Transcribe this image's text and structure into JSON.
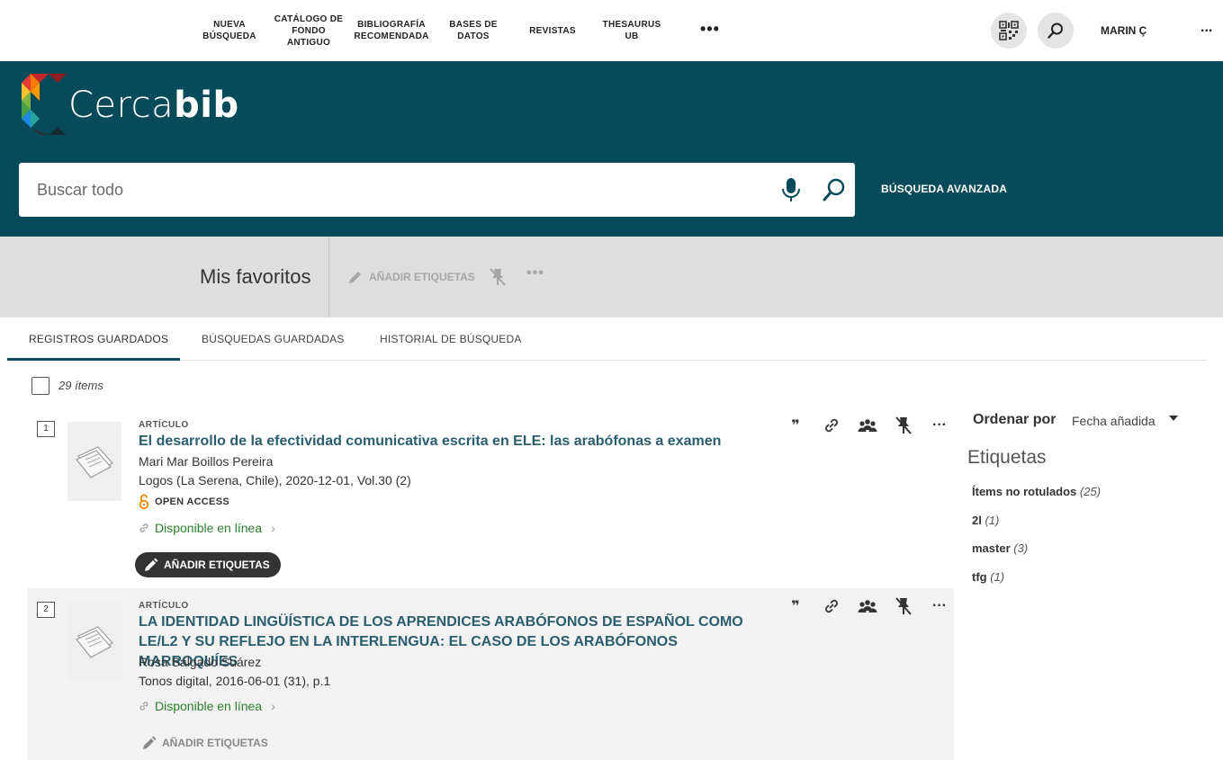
{
  "nav": {
    "items": [
      "NUEVA\nBÚSQUEDA",
      "CATÁLOGO DE\nFONDO\nANTIGUO",
      "BIBLIOGRAFÍA\nRECOMENDADA",
      "BASES DE\nDATOS",
      "REVISTAS",
      "THESAURUS\nUB"
    ],
    "more": "•••",
    "user": "MARIN Ç",
    "user_more": "..."
  },
  "header": {
    "logo_light": "Cerca",
    "logo_bold": "bib",
    "search_placeholder": "Buscar todo",
    "advanced": "BÚSQUEDA AVANZADA",
    "colors": {
      "band": "#074a5a"
    }
  },
  "favorites": {
    "title": "Mis favoritos",
    "add_tags": "AÑADIR ETIQUETAS",
    "more": "•••"
  },
  "tabs": [
    "REGISTROS GUARDADOS",
    "BÚSQUEDAS GUARDADAS",
    "HISTORIAL DE BÚSQUEDA"
  ],
  "count": "29 ítems",
  "results": [
    {
      "num": "1",
      "type": "ARTÍCULO",
      "title": "El desarrollo de la efectividad comunicativa escrita en ELE: las arabófonas a examen",
      "author": "Mari Mar Boillos Pereira",
      "source": "Logos (La Serena, Chile), 2020-12-01, Vol.30 (2)",
      "open_access": "OPEN ACCESS",
      "online": "Disponible en línea",
      "add_tags": "AÑADIR ETIQUETAS"
    },
    {
      "num": "2",
      "type": "ARTÍCULO",
      "title": "LA IDENTIDAD LINGÜÍSTICA DE LOS APRENDICES ARABÓFONOS DE ESPAÑOL COMO LE/L2 Y SU REFLEJO EN LA INTERLENGUA: EL CASO DE LOS ARABÓFONOS MARROQUÍES",
      "author": "Rosa Salgado Suárez",
      "source": "Tonos digital, 2016-06-01 (31), p.1",
      "online": "Disponible en línea",
      "add_tags": "AÑADIR ETIQUETAS"
    }
  ],
  "sidebar": {
    "sort_label": "Ordenar por",
    "sort_value": "Fecha añadida",
    "tags_heading": "Etiquetas",
    "tags": [
      {
        "name": "Ítems no rotulados",
        "count": "(25)"
      },
      {
        "name": "2l",
        "count": "(1)"
      },
      {
        "name": "master",
        "count": "(3)"
      },
      {
        "name": "tfg",
        "count": "(1)"
      }
    ]
  }
}
